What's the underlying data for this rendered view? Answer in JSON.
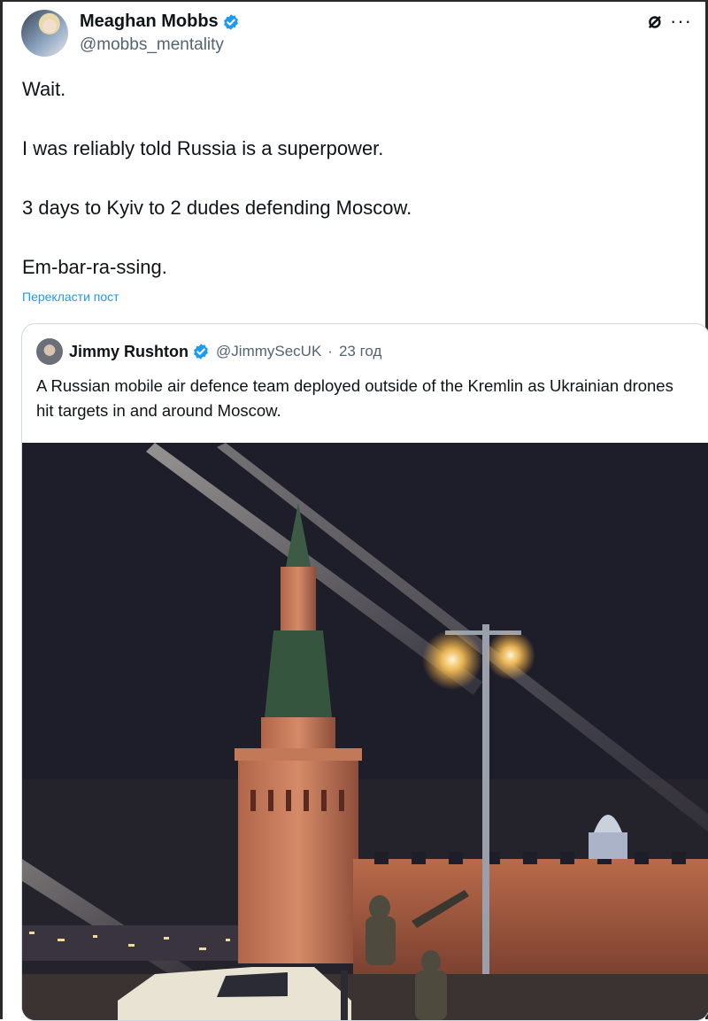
{
  "tweet": {
    "author": {
      "display_name": "Meaghan Mobbs",
      "handle": "@mobbs_mentality",
      "verified": true
    },
    "icons": {
      "grok": "grok-icon",
      "more": "more-icon"
    },
    "text_lines": [
      "Wait.",
      "I was reliably told Russia is a superpower.",
      "3 days to Kyiv to 2 dudes defending Moscow.",
      "Em-bar-ra-ssing."
    ],
    "translate_label": "Перекласти пост"
  },
  "quote": {
    "author": {
      "display_name": "Jimmy Rushton",
      "handle": "@JimmySecUK",
      "separator": "·",
      "time": "23 год",
      "verified": true
    },
    "text": "A Russian mobile air defence team deployed outside of the Kremlin as Ukrainian drones hit targets in and around Moscow.",
    "media": {
      "kind": "photo",
      "subject": "kremlin-tower-night-scene"
    }
  },
  "colors": {
    "accent": "#1d9bf0",
    "secondary_text": "#536471",
    "text": "#0f1419",
    "border": "#cfd9de",
    "night_sky": "#1e1d2a",
    "lamp_glow": "#ffd27a"
  }
}
